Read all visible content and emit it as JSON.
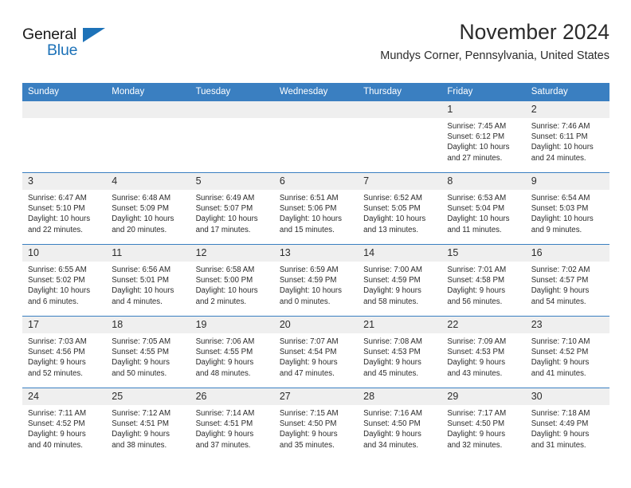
{
  "brand": {
    "name_top": "General",
    "name_bottom": "Blue",
    "triangle_color": "#1d72b8"
  },
  "header": {
    "title": "November 2024",
    "subtitle": "Mundys Corner, Pennsylvania, United States"
  },
  "theme": {
    "header_bg": "#3a7fc1",
    "header_text": "#ffffff",
    "daynum_bg": "#efefef",
    "row_divider": "#3a7fc1",
    "cell_bg": "#ffffff",
    "text": "#2b2b2b"
  },
  "weekday_headers": [
    "Sunday",
    "Monday",
    "Tuesday",
    "Wednesday",
    "Thursday",
    "Friday",
    "Saturday"
  ],
  "labels": {
    "sunrise_prefix": "Sunrise:",
    "sunset_prefix": "Sunset:",
    "daylight_prefix": "Daylight:"
  },
  "weeks": [
    [
      {
        "day": "",
        "sunrise": "",
        "sunset": "",
        "daylight_1": "",
        "daylight_2": ""
      },
      {
        "day": "",
        "sunrise": "",
        "sunset": "",
        "daylight_1": "",
        "daylight_2": ""
      },
      {
        "day": "",
        "sunrise": "",
        "sunset": "",
        "daylight_1": "",
        "daylight_2": ""
      },
      {
        "day": "",
        "sunrise": "",
        "sunset": "",
        "daylight_1": "",
        "daylight_2": ""
      },
      {
        "day": "",
        "sunrise": "",
        "sunset": "",
        "daylight_1": "",
        "daylight_2": ""
      },
      {
        "day": "1",
        "sunrise": "Sunrise: 7:45 AM",
        "sunset": "Sunset: 6:12 PM",
        "daylight_1": "Daylight: 10 hours",
        "daylight_2": "and 27 minutes."
      },
      {
        "day": "2",
        "sunrise": "Sunrise: 7:46 AM",
        "sunset": "Sunset: 6:11 PM",
        "daylight_1": "Daylight: 10 hours",
        "daylight_2": "and 24 minutes."
      }
    ],
    [
      {
        "day": "3",
        "sunrise": "Sunrise: 6:47 AM",
        "sunset": "Sunset: 5:10 PM",
        "daylight_1": "Daylight: 10 hours",
        "daylight_2": "and 22 minutes."
      },
      {
        "day": "4",
        "sunrise": "Sunrise: 6:48 AM",
        "sunset": "Sunset: 5:09 PM",
        "daylight_1": "Daylight: 10 hours",
        "daylight_2": "and 20 minutes."
      },
      {
        "day": "5",
        "sunrise": "Sunrise: 6:49 AM",
        "sunset": "Sunset: 5:07 PM",
        "daylight_1": "Daylight: 10 hours",
        "daylight_2": "and 17 minutes."
      },
      {
        "day": "6",
        "sunrise": "Sunrise: 6:51 AM",
        "sunset": "Sunset: 5:06 PM",
        "daylight_1": "Daylight: 10 hours",
        "daylight_2": "and 15 minutes."
      },
      {
        "day": "7",
        "sunrise": "Sunrise: 6:52 AM",
        "sunset": "Sunset: 5:05 PM",
        "daylight_1": "Daylight: 10 hours",
        "daylight_2": "and 13 minutes."
      },
      {
        "day": "8",
        "sunrise": "Sunrise: 6:53 AM",
        "sunset": "Sunset: 5:04 PM",
        "daylight_1": "Daylight: 10 hours",
        "daylight_2": "and 11 minutes."
      },
      {
        "day": "9",
        "sunrise": "Sunrise: 6:54 AM",
        "sunset": "Sunset: 5:03 PM",
        "daylight_1": "Daylight: 10 hours",
        "daylight_2": "and 9 minutes."
      }
    ],
    [
      {
        "day": "10",
        "sunrise": "Sunrise: 6:55 AM",
        "sunset": "Sunset: 5:02 PM",
        "daylight_1": "Daylight: 10 hours",
        "daylight_2": "and 6 minutes."
      },
      {
        "day": "11",
        "sunrise": "Sunrise: 6:56 AM",
        "sunset": "Sunset: 5:01 PM",
        "daylight_1": "Daylight: 10 hours",
        "daylight_2": "and 4 minutes."
      },
      {
        "day": "12",
        "sunrise": "Sunrise: 6:58 AM",
        "sunset": "Sunset: 5:00 PM",
        "daylight_1": "Daylight: 10 hours",
        "daylight_2": "and 2 minutes."
      },
      {
        "day": "13",
        "sunrise": "Sunrise: 6:59 AM",
        "sunset": "Sunset: 4:59 PM",
        "daylight_1": "Daylight: 10 hours",
        "daylight_2": "and 0 minutes."
      },
      {
        "day": "14",
        "sunrise": "Sunrise: 7:00 AM",
        "sunset": "Sunset: 4:59 PM",
        "daylight_1": "Daylight: 9 hours",
        "daylight_2": "and 58 minutes."
      },
      {
        "day": "15",
        "sunrise": "Sunrise: 7:01 AM",
        "sunset": "Sunset: 4:58 PM",
        "daylight_1": "Daylight: 9 hours",
        "daylight_2": "and 56 minutes."
      },
      {
        "day": "16",
        "sunrise": "Sunrise: 7:02 AM",
        "sunset": "Sunset: 4:57 PM",
        "daylight_1": "Daylight: 9 hours",
        "daylight_2": "and 54 minutes."
      }
    ],
    [
      {
        "day": "17",
        "sunrise": "Sunrise: 7:03 AM",
        "sunset": "Sunset: 4:56 PM",
        "daylight_1": "Daylight: 9 hours",
        "daylight_2": "and 52 minutes."
      },
      {
        "day": "18",
        "sunrise": "Sunrise: 7:05 AM",
        "sunset": "Sunset: 4:55 PM",
        "daylight_1": "Daylight: 9 hours",
        "daylight_2": "and 50 minutes."
      },
      {
        "day": "19",
        "sunrise": "Sunrise: 7:06 AM",
        "sunset": "Sunset: 4:55 PM",
        "daylight_1": "Daylight: 9 hours",
        "daylight_2": "and 48 minutes."
      },
      {
        "day": "20",
        "sunrise": "Sunrise: 7:07 AM",
        "sunset": "Sunset: 4:54 PM",
        "daylight_1": "Daylight: 9 hours",
        "daylight_2": "and 47 minutes."
      },
      {
        "day": "21",
        "sunrise": "Sunrise: 7:08 AM",
        "sunset": "Sunset: 4:53 PM",
        "daylight_1": "Daylight: 9 hours",
        "daylight_2": "and 45 minutes."
      },
      {
        "day": "22",
        "sunrise": "Sunrise: 7:09 AM",
        "sunset": "Sunset: 4:53 PM",
        "daylight_1": "Daylight: 9 hours",
        "daylight_2": "and 43 minutes."
      },
      {
        "day": "23",
        "sunrise": "Sunrise: 7:10 AM",
        "sunset": "Sunset: 4:52 PM",
        "daylight_1": "Daylight: 9 hours",
        "daylight_2": "and 41 minutes."
      }
    ],
    [
      {
        "day": "24",
        "sunrise": "Sunrise: 7:11 AM",
        "sunset": "Sunset: 4:52 PM",
        "daylight_1": "Daylight: 9 hours",
        "daylight_2": "and 40 minutes."
      },
      {
        "day": "25",
        "sunrise": "Sunrise: 7:12 AM",
        "sunset": "Sunset: 4:51 PM",
        "daylight_1": "Daylight: 9 hours",
        "daylight_2": "and 38 minutes."
      },
      {
        "day": "26",
        "sunrise": "Sunrise: 7:14 AM",
        "sunset": "Sunset: 4:51 PM",
        "daylight_1": "Daylight: 9 hours",
        "daylight_2": "and 37 minutes."
      },
      {
        "day": "27",
        "sunrise": "Sunrise: 7:15 AM",
        "sunset": "Sunset: 4:50 PM",
        "daylight_1": "Daylight: 9 hours",
        "daylight_2": "and 35 minutes."
      },
      {
        "day": "28",
        "sunrise": "Sunrise: 7:16 AM",
        "sunset": "Sunset: 4:50 PM",
        "daylight_1": "Daylight: 9 hours",
        "daylight_2": "and 34 minutes."
      },
      {
        "day": "29",
        "sunrise": "Sunrise: 7:17 AM",
        "sunset": "Sunset: 4:50 PM",
        "daylight_1": "Daylight: 9 hours",
        "daylight_2": "and 32 minutes."
      },
      {
        "day": "30",
        "sunrise": "Sunrise: 7:18 AM",
        "sunset": "Sunset: 4:49 PM",
        "daylight_1": "Daylight: 9 hours",
        "daylight_2": "and 31 minutes."
      }
    ]
  ]
}
